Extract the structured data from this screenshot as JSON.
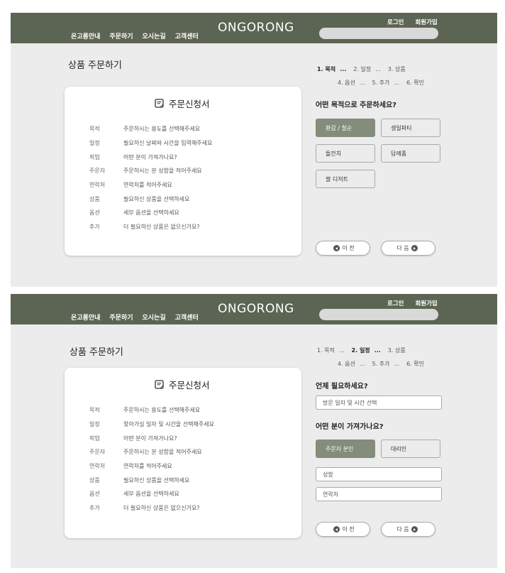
{
  "header": {
    "nav": [
      "온고롱안내",
      "주문하기",
      "오시는길",
      "고객센터"
    ],
    "logo": "ONGORONG",
    "login": "로그인",
    "signup": "회원가입"
  },
  "page_title": "상품 주문하기",
  "steps": {
    "row1": [
      "1. 목적",
      "2. 일정",
      "3. 상품"
    ],
    "row2": [
      "4. 옵션",
      "5. 추가",
      "6. 확인"
    ],
    "dots": "..."
  },
  "form": {
    "title": "주문신청서",
    "labels": [
      "목적",
      "일정",
      "픽업",
      "주문자",
      "연락처",
      "상품",
      "옵션",
      "추가"
    ],
    "values_step1": [
      "주문하시는 용도를 선택해주세요",
      "필요하신 날짜와 시간을 입력해주세요",
      "어떤 분이 가져가나요?",
      "주문하시는 분 성함을 적어주세요",
      "연락처를 적어주세요",
      "필요하신 상품을 선택하세요",
      "세부 옵션을 선택하세요",
      "더 필요하신 상품은 없으신가요?"
    ],
    "values_step2": [
      "주문하시는 용도를 선택해주세요",
      "찾아가실 일자 및 시간을 선택해주세요",
      "어떤 분이 가져가나요?",
      "주문하시는 분 성함을 적어주세요",
      "연락처를 적어주세요",
      "필요하신 상품을 선택하세요",
      "세부 옵션을 선택하세요",
      "더 필요하신 상품은 없으신가요?"
    ]
  },
  "step1": {
    "question": "어떤 목적으로 주문하세요?",
    "options": [
      "환갑 / 칠순",
      "생일파티",
      "돌잔치",
      "답례품",
      "쌀 디저트"
    ]
  },
  "step2": {
    "question_date": "언제 필요하세요?",
    "date_placeholder": "방문 일자 및 시간 선택",
    "question_pickup": "어떤 분이 가져가나요?",
    "pickup_options": [
      "주문자 본인",
      "대리인"
    ],
    "name_placeholder": "성함",
    "phone_placeholder": "연락처"
  },
  "buttons": {
    "prev": "이 전",
    "next": "다 음"
  },
  "colors": {
    "header_bg": "#5c6553",
    "selected_option": "#848c7b",
    "panel_bg": "#ececec"
  }
}
